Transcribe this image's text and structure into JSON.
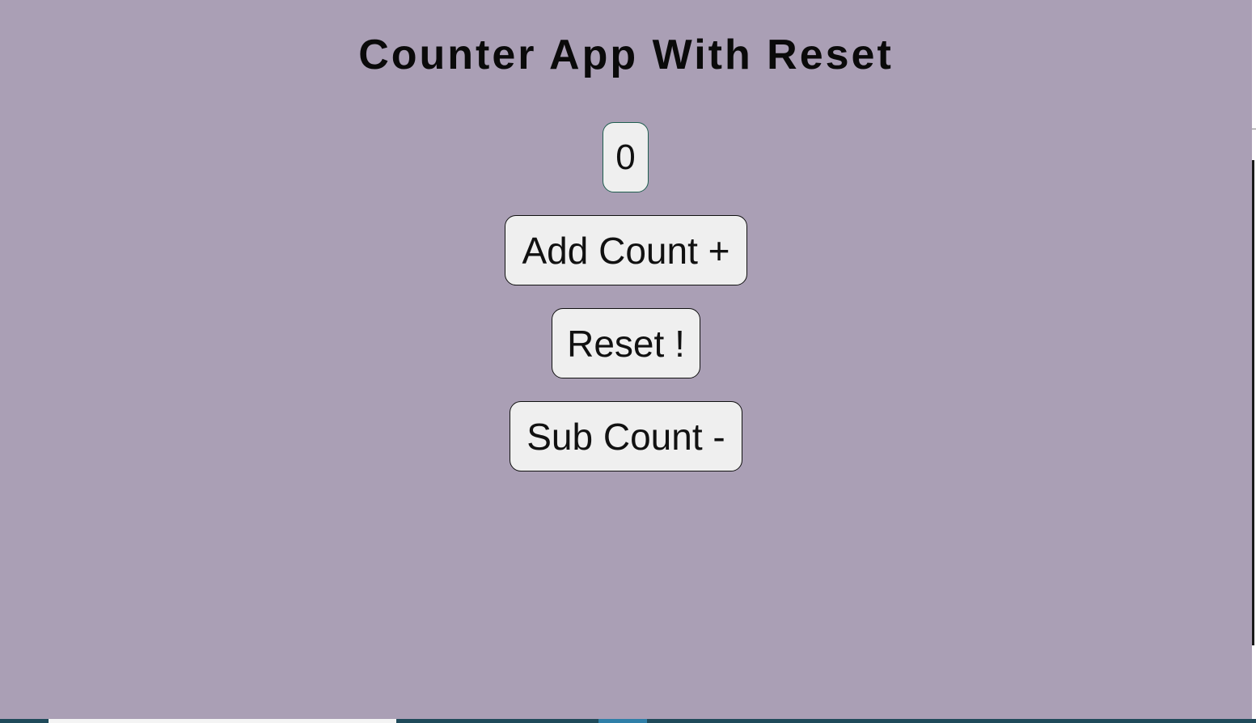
{
  "app": {
    "title": "Counter App With Reset",
    "count_value": "0",
    "buttons": {
      "add_label": "Add Count +",
      "reset_label": "Reset !",
      "sub_label": "Sub Count -"
    }
  },
  "colors": {
    "background": "#aa9fb5",
    "button_bg": "#efefef",
    "counter_border": "#1f5e50"
  }
}
